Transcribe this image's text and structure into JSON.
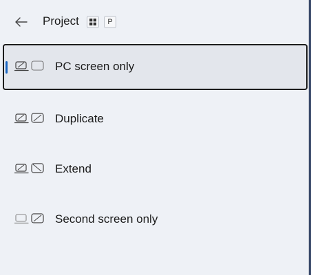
{
  "header": {
    "title": "Project",
    "back_icon": "back-arrow-icon",
    "shortcut_keys": [
      "windows-key-icon",
      "P"
    ]
  },
  "options": [
    {
      "label": "PC screen only",
      "icon": "pc-screen-only-icon",
      "selected": true
    },
    {
      "label": "Duplicate",
      "icon": "duplicate-icon",
      "selected": false
    },
    {
      "label": "Extend",
      "icon": "extend-icon",
      "selected": false
    },
    {
      "label": "Second screen only",
      "icon": "second-screen-only-icon",
      "selected": false
    }
  ],
  "colors": {
    "accent": "#1a66c2",
    "panel_background": "#eef1f6",
    "selected_background": "#e3e6ec"
  }
}
